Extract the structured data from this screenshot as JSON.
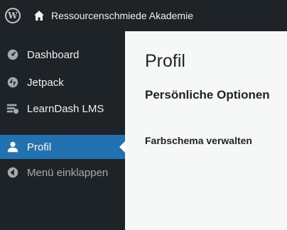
{
  "admin_bar": {
    "site_name": "Ressourcenschmiede Akademie"
  },
  "sidebar": {
    "items": [
      {
        "label": "Dashboard",
        "icon": "dashboard-icon"
      },
      {
        "label": "Jetpack",
        "icon": "jetpack-icon"
      },
      {
        "label": "LearnDash LMS",
        "icon": "learndash-icon"
      },
      {
        "label": "Profil",
        "icon": "user-icon",
        "active": true
      },
      {
        "label": "Menü einklappen",
        "icon": "collapse-icon"
      }
    ]
  },
  "main": {
    "page_title": "Profil",
    "section_title": "Persönliche Optionen",
    "field_label": "Farbschema verwalten"
  },
  "colors": {
    "admin_dark": "#1d2327",
    "active_blue": "#2271b1",
    "content_bg": "#f6f7f7"
  }
}
